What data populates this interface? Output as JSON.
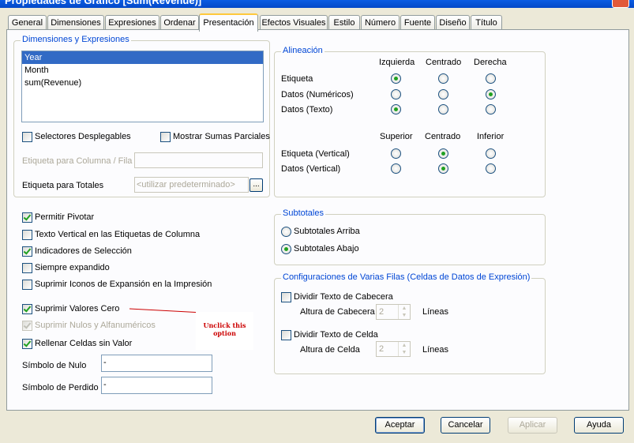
{
  "window": {
    "title": "Propiedades de Gráfico [Sum(Revenue)]"
  },
  "tabs": [
    "General",
    "Dimensiones",
    "Expresiones",
    "Ordenar",
    "Presentación",
    "Efectos Visuales",
    "Estilo",
    "Número",
    "Fuente",
    "Diseño",
    "Título"
  ],
  "active_tab": "Presentación",
  "dims": {
    "group_label": "Dimensiones y Expresiones",
    "items": [
      {
        "label": "Year",
        "selected": true
      },
      {
        "label": "Month",
        "selected": false
      },
      {
        "label": "sum(Revenue)",
        "selected": false
      }
    ],
    "selectores_label": "Selectores Desplegables",
    "selectores_checked": false,
    "sumas_label": "Mostrar Sumas Parciales",
    "sumas_checked": false,
    "etiqueta_columna_label": "Etiqueta para Columna / Fila",
    "etiqueta_columna_value": "",
    "etiqueta_totales_label": "Etiqueta para Totales",
    "etiqueta_totales_value": "<utilizar predeterminado>",
    "ellipsis": "..."
  },
  "options": {
    "permitir_pivotar": {
      "label": "Permitir Pivotar",
      "checked": true
    },
    "texto_vertical": {
      "label": "Texto Vertical en las Etiquetas de Columna",
      "checked": false
    },
    "indicadores": {
      "label": "Indicadores de Selección",
      "checked": true
    },
    "siempre_expandido": {
      "label": "Siempre expandido",
      "checked": false
    },
    "suprimir_iconos": {
      "label": "Suprimir Iconos de Expansión en la Impresión",
      "checked": false
    },
    "suprimir_cero": {
      "label": "Suprimir Valores Cero",
      "checked": true
    },
    "suprimir_nulos": {
      "label": "Suprimir Nulos y Alfanuméricos",
      "checked": true,
      "disabled": true
    },
    "rellenar": {
      "label": "Rellenar Celdas sin Valor",
      "checked": true
    }
  },
  "simbolos": {
    "nulo_label": "Símbolo de Nulo",
    "nulo_value": "-",
    "perdido_label": "Símbolo de Perdido",
    "perdido_value": "-"
  },
  "annotation": {
    "text": "Unclick this option",
    "color": "#cc0000"
  },
  "alineacion": {
    "group_label": "Alineación",
    "cols_h": [
      "Izquierda",
      "Centrado",
      "Derecha"
    ],
    "rows_h": [
      {
        "label": "Etiqueta",
        "selected": 0
      },
      {
        "label": "Datos (Numéricos)",
        "selected": 2
      },
      {
        "label": "Datos (Texto)",
        "selected": 0
      }
    ],
    "cols_v": [
      "Superior",
      "Centrado",
      "Inferior"
    ],
    "rows_v": [
      {
        "label": "Etiqueta (Vertical)",
        "selected": 1
      },
      {
        "label": "Datos (Vertical)",
        "selected": 1
      }
    ]
  },
  "subtotales": {
    "group_label": "Subtotales",
    "arriba": {
      "label": "Subtotales Arriba",
      "selected": false
    },
    "abajo": {
      "label": "Subtotales Abajo",
      "selected": true
    }
  },
  "varias_filas": {
    "group_label": "Configuraciones de Varias Filas (Celdas de Datos de Expresión)",
    "cabecera_label": "Dividir Texto de Cabecera",
    "cabecera_checked": false,
    "altura_cabecera_label": "Altura de Cabecera",
    "altura_cabecera_value": "2",
    "celda_label": "Dividir Texto de Celda",
    "celda_checked": false,
    "altura_celda_label": "Altura de Celda",
    "altura_celda_value": "2",
    "lineas": "Líneas"
  },
  "buttons": {
    "aceptar": "Aceptar",
    "cancelar": "Cancelar",
    "aplicar": "Aplicar",
    "ayuda": "Ayuda"
  }
}
